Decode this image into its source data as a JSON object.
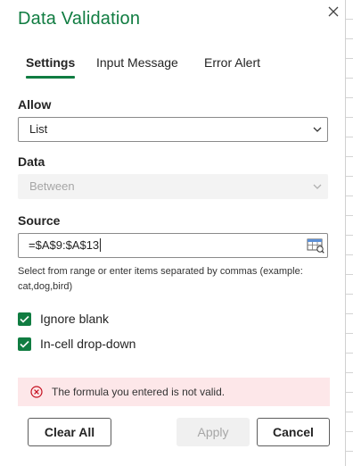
{
  "dialog": {
    "title": "Data Validation",
    "close_icon": "close-icon"
  },
  "tabs": [
    {
      "label": "Settings",
      "active": true
    },
    {
      "label": "Input Message",
      "active": false
    },
    {
      "label": "Error Alert",
      "active": false
    }
  ],
  "allow": {
    "label": "Allow",
    "value": "List"
  },
  "data": {
    "label": "Data",
    "value": "Between",
    "disabled": true
  },
  "source": {
    "label": "Source",
    "value": "=$A$9:$A$13",
    "help": "Select from range or enter items separated by commas (example: cat,dog,bird)"
  },
  "options": {
    "ignore_blank": {
      "label": "Ignore blank",
      "checked": true
    },
    "in_cell_dropdown": {
      "label": "In-cell drop-down",
      "checked": true
    }
  },
  "error": {
    "message": "The formula you entered is not valid.",
    "icon": "error-circle-icon"
  },
  "buttons": {
    "clear_all": "Clear All",
    "apply": "Apply",
    "cancel": "Cancel"
  },
  "colors": {
    "accent": "#107c41",
    "error_bg": "#fde7e9",
    "error_icon": "#c50f1f"
  }
}
